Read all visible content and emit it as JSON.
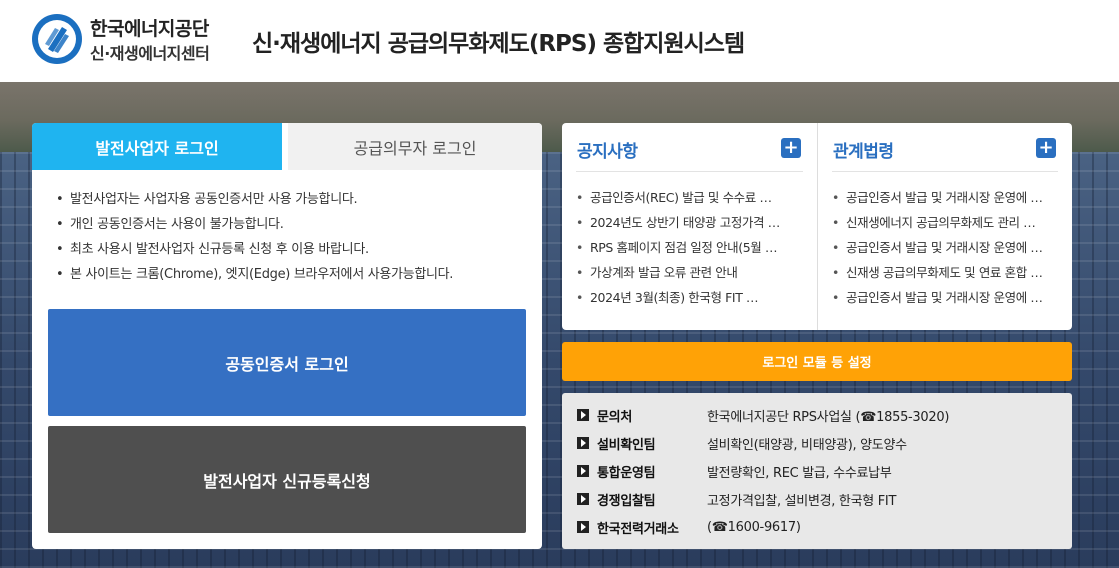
{
  "header": {
    "org_name": "한국에너지공단",
    "org_sub": "신·재생에너지센터",
    "system_title": "신·재생에너지 공급의무화제도(RPS) 종합지원시스템"
  },
  "login": {
    "tabs": [
      {
        "label": "발전사업자 로그인",
        "active": true
      },
      {
        "label": "공급의무자 로그인",
        "active": false
      }
    ],
    "notes": [
      "발전사업자는 사업자용 공동인증서만 사용 가능합니다.",
      "개인 공동인증서는 사용이 불가능합니다.",
      "최초 사용시 발전사업자 신규등록 신청 후 이용 바랍니다.",
      "본 사이트는 크롬(Chrome), 엣지(Edge) 브라우저에서 사용가능합니다."
    ],
    "cert_login_label": "공동인증서 로그인",
    "register_label": "발전사업자 신규등록신청"
  },
  "notices": {
    "title": "공지사항",
    "plus": "+",
    "items": [
      "공급인증서(REC) 발급 및 수수료 …",
      "2024년도 상반기 태양광 고정가격 …",
      "RPS 홈페이지 점검 일정 안내(5월 …",
      "가상계좌 발급 오류 관련 안내",
      "2024년 3월(최종) 한국형 FIT …"
    ]
  },
  "laws": {
    "title": "관계법령",
    "plus": "+",
    "items": [
      "공급인증서 발급 및 거래시장 운영에 …",
      "신재생에너지 공급의무화제도 관리 …",
      "공급인증서 발급 및 거래시장 운영에 …",
      "신재생 공급의무화제도 및 연료 혼합 …",
      "공급인증서 발급 및 거래시장 운영에 …"
    ]
  },
  "setup_button_label": "로그인 모듈 등 설정",
  "contacts": [
    {
      "label": "문의처",
      "value": "한국에너지공단 RPS사업실 (☎1855-3020)"
    },
    {
      "label": "설비확인팀",
      "value": "설비확인(태양광, 비태양광), 양도양수"
    },
    {
      "label": "통합운영팀",
      "value": "발전량확인, REC 발급, 수수료납부"
    },
    {
      "label": "경쟁입찰팀",
      "value": "고정가격입찰, 설비변경, 한국형 FIT"
    },
    {
      "label": "한국전력거래소",
      "value": "(☎1600-9617)"
    }
  ],
  "colors": {
    "tab_active": "#1fb4f0",
    "cert_button": "#3570c3",
    "register_button": "#4f4f4f",
    "setup_button": "#ffa206",
    "board_title": "#2a6fc0"
  }
}
